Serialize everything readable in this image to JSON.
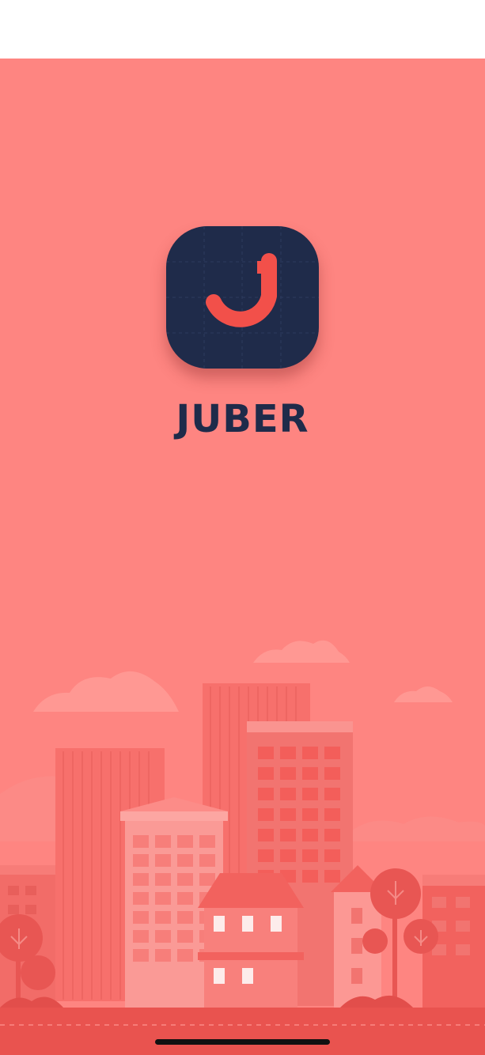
{
  "app": {
    "name": "JUBER",
    "icon": "juber-logo-icon",
    "colors": {
      "background": "#FE8581",
      "icon_background": "#1F2B4A",
      "accent": "#F2504A",
      "text": "#1F2B4A"
    }
  },
  "illustration": "city-skyline-illustration"
}
